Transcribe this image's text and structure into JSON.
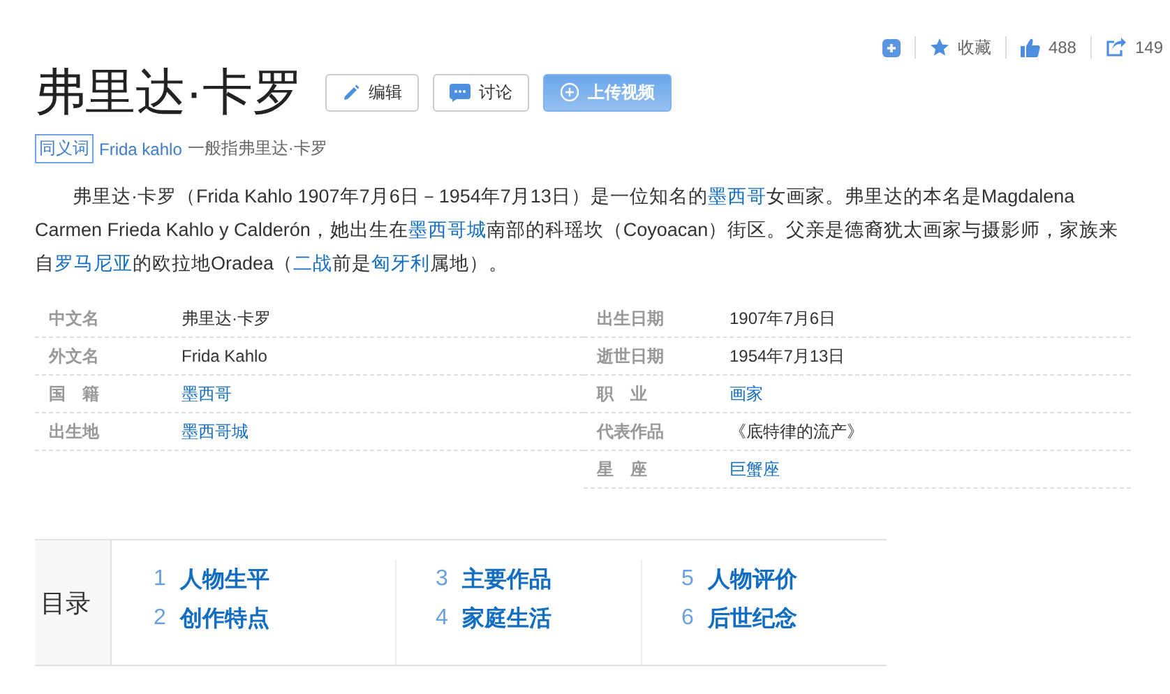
{
  "toolbar": {
    "favorite": "收藏",
    "likes": "488",
    "shares": "149"
  },
  "title": "弗里达·卡罗",
  "title_buttons": [
    {
      "kind": "edit",
      "label": "编辑"
    },
    {
      "kind": "discuss",
      "label": "讨论"
    },
    {
      "kind": "upload",
      "label": "上传视频"
    }
  ],
  "synonym": {
    "tag": "同义词",
    "term": "Frida kahlo",
    "note": "一般指弗里达·卡罗"
  },
  "summary": [
    {
      "text": "弗里达·卡罗（Frida Kahlo 1907年7月6日－1954年7月13日）是一位知名的",
      "link": false
    },
    {
      "text": "墨西哥",
      "link": true
    },
    {
      "text": "女画家。弗里达的本名是Magdalena Carmen Frieda Kahlo y Calderón，她出生在",
      "link": false
    },
    {
      "text": "墨西哥城",
      "link": true
    },
    {
      "text": "南部的科瑶坎（Coyoacan）街区。父亲是德裔犹太画家与摄影师，家族来自",
      "link": false
    },
    {
      "text": "罗马尼亚",
      "link": true
    },
    {
      "text": "的欧拉地Oradea（",
      "link": false
    },
    {
      "text": "二战",
      "link": true
    },
    {
      "text": "前是",
      "link": false
    },
    {
      "text": "匈牙利",
      "link": true
    },
    {
      "text": "属地）。",
      "link": false
    }
  ],
  "info_left": [
    {
      "label": "中文名",
      "value": "弗里达·卡罗",
      "link": false
    },
    {
      "label": "外文名",
      "value": "Frida Kahlo",
      "link": false
    },
    {
      "label": "国　籍",
      "value": "墨西哥",
      "link": true
    },
    {
      "label": "出生地",
      "value": "墨西哥城",
      "link": true
    }
  ],
  "info_right": [
    {
      "label": "出生日期",
      "value": "1907年7月6日",
      "link": false
    },
    {
      "label": "逝世日期",
      "value": "1954年7月13日",
      "link": false
    },
    {
      "label": "职　业",
      "value": "画家",
      "link": true
    },
    {
      "label": "代表作品",
      "value": "《底特律的流产》",
      "link": false
    },
    {
      "label": "星　座",
      "value": "巨蟹座",
      "link": true
    }
  ],
  "toc": {
    "heading": "目录",
    "items": [
      {
        "number": "1",
        "label": "人物生平"
      },
      {
        "number": "2",
        "label": "创作特点"
      },
      {
        "number": "3",
        "label": "主要作品"
      },
      {
        "number": "4",
        "label": "家庭生活"
      },
      {
        "number": "5",
        "label": "人物评价"
      },
      {
        "number": "6",
        "label": "后世纪念"
      }
    ]
  }
}
